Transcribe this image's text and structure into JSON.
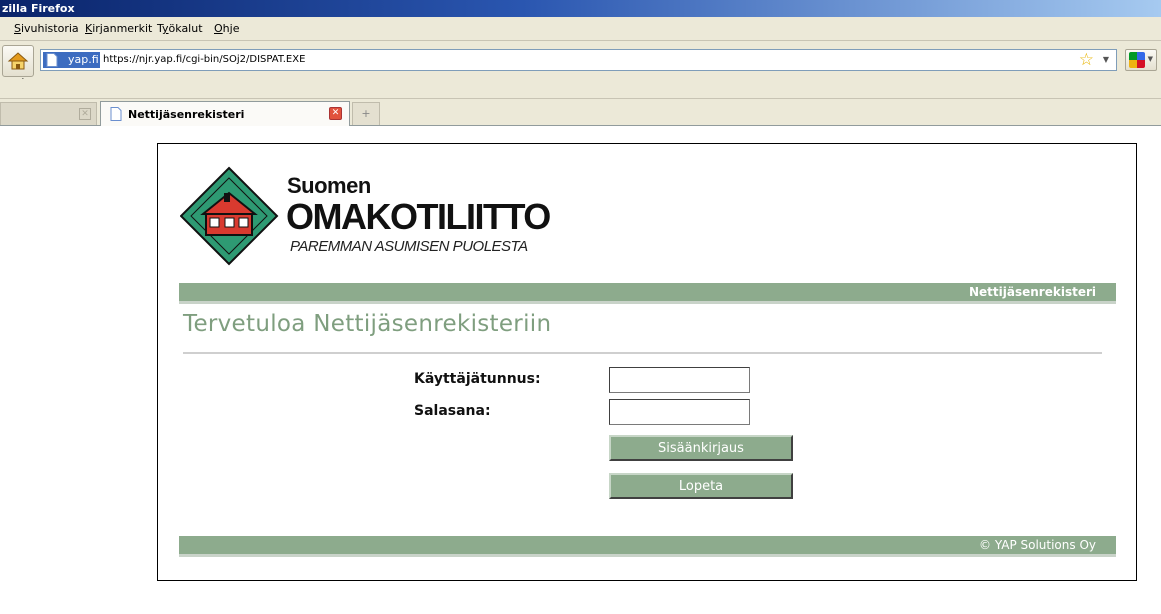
{
  "window": {
    "title": "zilla Firefox"
  },
  "menu": {
    "items": [
      {
        "accel": "S",
        "rest": "ivuhistoria"
      },
      {
        "accel": "K",
        "rest": "irjanmerkit"
      },
      {
        "pre": "T",
        "accel": "y",
        "rest": "ökalut"
      },
      {
        "accel": "O",
        "rest": "hje"
      }
    ]
  },
  "navbar": {
    "site_identity": "yap.fi",
    "url": "https://njr.yap.fi/cgi-bin/SOj2/DISPAT.EXE",
    "icons": {
      "home": "home-icon",
      "bookmark_star": "star-icon",
      "search_engine": "google-icon"
    }
  },
  "tabs": [
    {
      "label": "",
      "active": false
    },
    {
      "label": "Nettijäsenrekisteri",
      "active": true
    }
  ],
  "page": {
    "logo": {
      "line1": "Suomen",
      "line2": "OMAKOTILIITTO",
      "tagline": "PAREMMAN ASUMISEN PUOLESTA"
    },
    "header_bar_text": "Nettijäsenrekisteri",
    "welcome": "Tervetuloa Nettijäsenrekisteriin",
    "form": {
      "username_label": "Käyttäjätunnus:",
      "username_value": "",
      "password_label": "Salasana:",
      "password_value": "",
      "login_button": "Sisäänkirjaus",
      "quit_button": "Lopeta"
    },
    "footer": "© YAP Solutions Oy"
  },
  "colors": {
    "accent_green": "#8dab8d",
    "welcome_text": "#7f9e7f",
    "logo_diamond": "#2e9a73",
    "logo_house": "#d93a2f"
  }
}
